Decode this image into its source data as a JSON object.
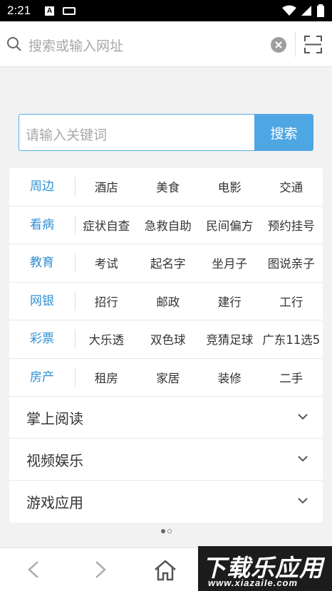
{
  "status_bar": {
    "time": "2:21",
    "notif_letter": "A"
  },
  "top_bar": {
    "address_placeholder": "搜索或输入网址"
  },
  "search": {
    "placeholder": "请输入关键词",
    "button_label": "搜索"
  },
  "categories": [
    {
      "name": "周边",
      "links": [
        "酒店",
        "美食",
        "电影",
        "交通"
      ]
    },
    {
      "name": "看病",
      "links": [
        "症状自查",
        "急救自助",
        "民间偏方",
        "预约挂号"
      ]
    },
    {
      "name": "教育",
      "links": [
        "考试",
        "起名字",
        "坐月子",
        "图说亲子"
      ]
    },
    {
      "name": "网银",
      "links": [
        "招行",
        "邮政",
        "建行",
        "工行"
      ]
    },
    {
      "name": "彩票",
      "links": [
        "大乐透",
        "双色球",
        "竞猜足球",
        "广东11选5"
      ]
    },
    {
      "name": "房产",
      "links": [
        "租房",
        "家居",
        "装修",
        "二手"
      ]
    }
  ],
  "sections": [
    "掌上阅读",
    "视频娱乐",
    "游戏应用"
  ],
  "page_indicator": {
    "count": 2,
    "active": 1
  },
  "watermark": {
    "title": "下载乐应用",
    "url": "www.xiazaiIe.com"
  },
  "colors": {
    "accent": "#4ea7e3",
    "category": "#2f8fd4"
  }
}
